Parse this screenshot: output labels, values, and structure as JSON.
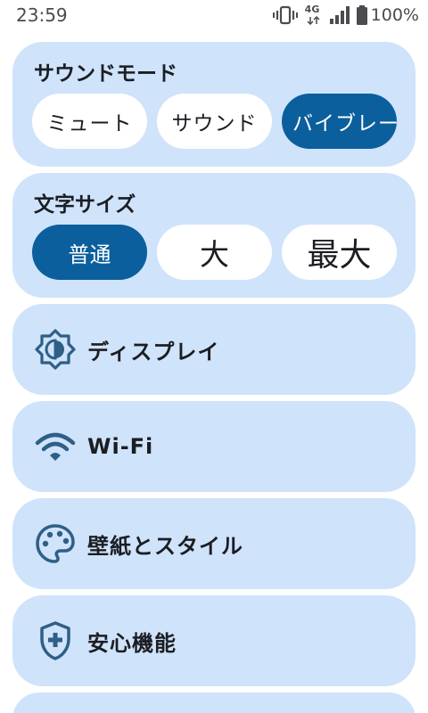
{
  "status_bar": {
    "time": "23:59",
    "network": "4G",
    "battery": "100%"
  },
  "sound_mode": {
    "title": "サウンドモード",
    "options": [
      {
        "label": "ミュート",
        "selected": false
      },
      {
        "label": "サウンド",
        "selected": false
      },
      {
        "label": "バイブレー",
        "selected": true
      }
    ]
  },
  "text_size": {
    "title": "文字サイズ",
    "options": [
      {
        "label": "普通",
        "selected": true
      },
      {
        "label": "大",
        "selected": false
      },
      {
        "label": "最大",
        "selected": false
      }
    ]
  },
  "menu": {
    "items": [
      {
        "label": "ディスプレイ",
        "icon": "brightness-icon"
      },
      {
        "label": "Wi-Fi",
        "icon": "wifi-icon"
      },
      {
        "label": "壁紙とスタイル",
        "icon": "palette-icon"
      },
      {
        "label": "安心機能",
        "icon": "shield-plus-icon"
      }
    ]
  },
  "colors": {
    "card_bg": "#cfe3fb",
    "accent": "#0b5f9c",
    "icon": "#2f5f86"
  }
}
